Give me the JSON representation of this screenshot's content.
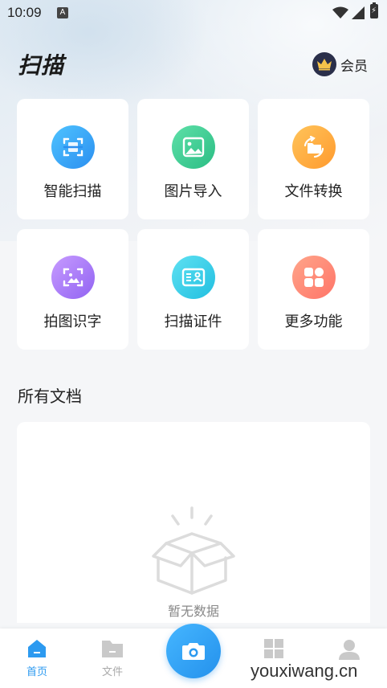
{
  "status_bar": {
    "time": "10:09",
    "notification_badge": "A",
    "icons": [
      "wifi-icon",
      "signal-icon",
      "battery-charging-icon"
    ]
  },
  "header": {
    "title": "扫描",
    "vip_label": "会员",
    "vip_icon": "crown-icon"
  },
  "features": [
    {
      "label": "智能扫描",
      "icon": "scan-frame-icon",
      "color_from": "#4fc3ff",
      "color_to": "#2b8ff0"
    },
    {
      "label": "图片导入",
      "icon": "image-icon",
      "color_from": "#5ee0a8",
      "color_to": "#2bbd84"
    },
    {
      "label": "文件转换",
      "icon": "folder-convert-icon",
      "color_from": "#ffc45a",
      "color_to": "#ff9a2e"
    },
    {
      "label": "拍图识字",
      "icon": "image-text-icon",
      "color_from": "#c79bff",
      "color_to": "#9163f2"
    },
    {
      "label": "扫描证件",
      "icon": "id-card-icon",
      "color_from": "#5fe1f2",
      "color_to": "#21bfe0"
    },
    {
      "label": "更多功能",
      "icon": "grid-apps-icon",
      "color_from": "#ffa58a",
      "color_to": "#ff7468"
    }
  ],
  "documents": {
    "section_title": "所有文档",
    "empty_text": "暂无数据",
    "empty_icon": "empty-box-icon"
  },
  "bottom_nav": {
    "items": [
      {
        "label": "首页",
        "icon": "home-icon",
        "active": true
      },
      {
        "label": "文件",
        "icon": "folder-icon",
        "active": false
      },
      {
        "label": "",
        "icon": "apps-icon",
        "active": false
      },
      {
        "label": "",
        "icon": "user-icon",
        "active": false
      }
    ],
    "camera_icon": "camera-icon",
    "active_color": "#2c9af0",
    "inactive_color": "#aaaaaa"
  },
  "watermark": "youxiwang.cn"
}
